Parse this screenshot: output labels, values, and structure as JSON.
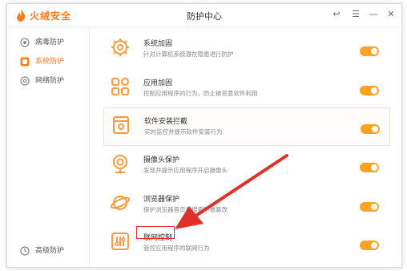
{
  "app": {
    "name": "火绒安全",
    "window_title": "防护中心"
  },
  "controls": {
    "back": "↩",
    "menu": "☰",
    "minimize": "—",
    "close": "✕"
  },
  "sidebar": {
    "items": [
      {
        "label": "病毒防护",
        "active": false
      },
      {
        "label": "系统防护",
        "active": true
      },
      {
        "label": "网络防护",
        "active": false
      }
    ],
    "bottom": {
      "label": "高级防护"
    }
  },
  "rows": [
    {
      "title": "系统加固",
      "desc": "针对计算机系统潜在隐患进行防护",
      "enabled": true
    },
    {
      "title": "应用加固",
      "desc": "控制应用程序的行为，防止被恶意软件利用",
      "enabled": true
    },
    {
      "title": "软件安装拦截",
      "desc": "实时监控并提示软件安装行为",
      "enabled": true
    },
    {
      "title": "摄像头保护",
      "desc": "发现并提示应用程序开启摄像头",
      "enabled": true
    },
    {
      "title": "浏览器保护",
      "desc": "保护浏览器首页和搜索不被篡改",
      "enabled": true
    },
    {
      "title": "联网控制",
      "desc": "管控应用程序的联网行为",
      "enabled": true
    }
  ],
  "colors": {
    "accent": "#ff7a1a",
    "toggle_on": "#ffa320",
    "annotation": "#e0302a"
  }
}
